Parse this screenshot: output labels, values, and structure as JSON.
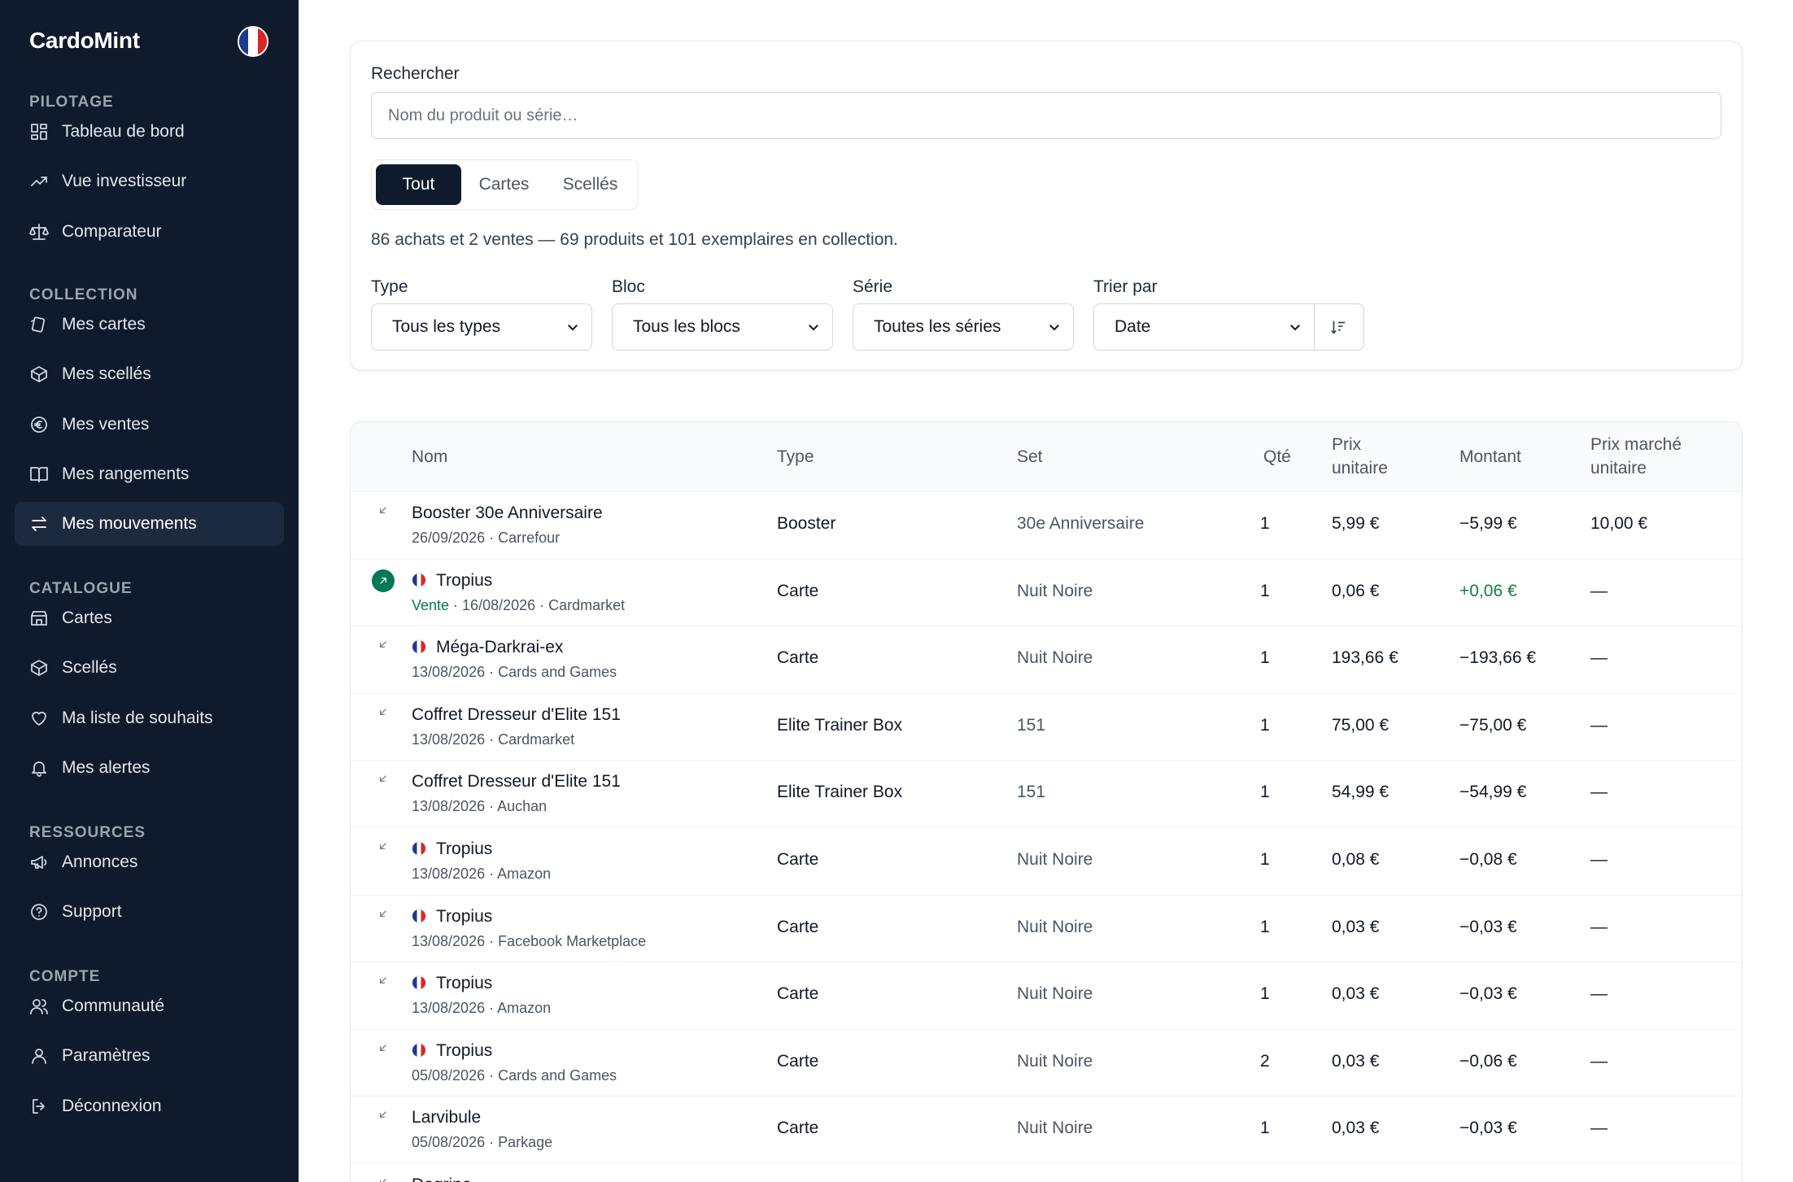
{
  "app": {
    "name": "CardoMint",
    "language_flag_colors": [
      "#1e3a8a",
      "#ffffff",
      "#dc2626"
    ],
    "accent": "#0f1b2d",
    "positive": "#15803d"
  },
  "sidebar": {
    "sections": [
      {
        "title": "PILOTAGE",
        "items": [
          {
            "label": "Tableau de bord",
            "icon": "grid-icon"
          },
          {
            "label": "Vue investisseur",
            "icon": "trending-up-icon"
          },
          {
            "label": "Comparateur",
            "icon": "scale-icon"
          }
        ]
      },
      {
        "title": "COLLECTION",
        "items": [
          {
            "label": "Mes cartes",
            "icon": "cards-icon"
          },
          {
            "label": "Mes scellés",
            "icon": "box-icon"
          },
          {
            "label": "Mes ventes",
            "icon": "euro-icon"
          },
          {
            "label": "Mes rangements",
            "icon": "book-icon"
          },
          {
            "label": "Mes mouvements",
            "icon": "arrows-icon",
            "active": true
          }
        ]
      },
      {
        "title": "CATALOGUE",
        "items": [
          {
            "label": "Cartes",
            "icon": "store-icon"
          },
          {
            "label": "Scellés",
            "icon": "box-icon"
          },
          {
            "label": "Ma liste de souhaits",
            "icon": "heart-icon"
          },
          {
            "label": "Mes alertes",
            "icon": "bell-icon"
          }
        ]
      },
      {
        "title": "RESSOURCES",
        "items": [
          {
            "label": "Annonces",
            "icon": "megaphone-icon"
          },
          {
            "label": "Support",
            "icon": "help-icon"
          }
        ]
      },
      {
        "title": "COMPTE",
        "items": [
          {
            "label": "Communauté",
            "icon": "users-icon"
          },
          {
            "label": "Paramètres",
            "icon": "user-icon"
          },
          {
            "label": "Déconnexion",
            "icon": "logout-icon"
          }
        ]
      }
    ]
  },
  "filters": {
    "search_label": "Rechercher",
    "search_placeholder": "Nom du produit ou série…",
    "search_value": "",
    "segments": [
      "Tout",
      "Cartes",
      "Scellés"
    ],
    "active_segment": "Tout",
    "summary": "86 achats et 2 ventes — 69 produits et 101 exemplaires en collection.",
    "type_label": "Type",
    "type_value": "Tous les types",
    "bloc_label": "Bloc",
    "bloc_value": "Tous les blocs",
    "serie_label": "Série",
    "serie_value": "Toutes les séries",
    "sort_label": "Trier par",
    "sort_value": "Date"
  },
  "table": {
    "headers": {
      "nom": "Nom",
      "type": "Type",
      "set": "Set",
      "qte": "Qté",
      "prix_unitaire": "Prix unitaire",
      "montant": "Montant",
      "prix_marche": "Prix marché unitaire"
    },
    "rows": [
      {
        "direction": "achat",
        "flag": false,
        "name": "Booster 30e Anniversaire",
        "sale_label": "",
        "meta": "26/09/2026 · Carrefour",
        "type": "Booster",
        "set": "30e Anniversaire",
        "qty": "1",
        "unit": "5,99 €",
        "amount": "−5,99 €",
        "market": "10,00 €"
      },
      {
        "direction": "vente",
        "flag": true,
        "name": "Tropius",
        "sale_label": "Vente",
        "meta": " · 16/08/2026 · Cardmarket",
        "type": "Carte",
        "set": "Nuit Noire",
        "qty": "1",
        "unit": "0,06 €",
        "amount": "+0,06 €",
        "market": "—"
      },
      {
        "direction": "achat",
        "flag": true,
        "name": "Méga-Darkrai-ex",
        "sale_label": "",
        "meta": "13/08/2026 · Cards and Games",
        "type": "Carte",
        "set": "Nuit Noire",
        "qty": "1",
        "unit": "193,66 €",
        "amount": "−193,66 €",
        "market": "—"
      },
      {
        "direction": "achat",
        "flag": false,
        "name": "Coffret Dresseur d'Elite 151",
        "sale_label": "",
        "meta": "13/08/2026 · Cardmarket",
        "type": "Elite Trainer Box",
        "set": "151",
        "qty": "1",
        "unit": "75,00 €",
        "amount": "−75,00 €",
        "market": "—"
      },
      {
        "direction": "achat",
        "flag": false,
        "name": "Coffret Dresseur d'Elite 151",
        "sale_label": "",
        "meta": "13/08/2026 · Auchan",
        "type": "Elite Trainer Box",
        "set": "151",
        "qty": "1",
        "unit": "54,99 €",
        "amount": "−54,99 €",
        "market": "—"
      },
      {
        "direction": "achat",
        "flag": true,
        "name": "Tropius",
        "sale_label": "",
        "meta": "13/08/2026 · Amazon",
        "type": "Carte",
        "set": "Nuit Noire",
        "qty": "1",
        "unit": "0,08 €",
        "amount": "−0,08 €",
        "market": "—"
      },
      {
        "direction": "achat",
        "flag": true,
        "name": "Tropius",
        "sale_label": "",
        "meta": "13/08/2026 · Facebook Marketplace",
        "type": "Carte",
        "set": "Nuit Noire",
        "qty": "1",
        "unit": "0,03 €",
        "amount": "−0,03 €",
        "market": "—"
      },
      {
        "direction": "achat",
        "flag": true,
        "name": "Tropius",
        "sale_label": "",
        "meta": "13/08/2026 · Amazon",
        "type": "Carte",
        "set": "Nuit Noire",
        "qty": "1",
        "unit": "0,03 €",
        "amount": "−0,03 €",
        "market": "—"
      },
      {
        "direction": "achat",
        "flag": true,
        "name": "Tropius",
        "sale_label": "",
        "meta": "05/08/2026 · Cards and Games",
        "type": "Carte",
        "set": "Nuit Noire",
        "qty": "2",
        "unit": "0,03 €",
        "amount": "−0,06 €",
        "market": "—"
      },
      {
        "direction": "achat",
        "flag": false,
        "name": "Larvibule",
        "sale_label": "",
        "meta": "05/08/2026 · Parkage",
        "type": "Carte",
        "set": "Nuit Noire",
        "qty": "1",
        "unit": "0,03 €",
        "amount": "−0,03 €",
        "market": "—"
      },
      {
        "direction": "achat",
        "flag": false,
        "name": "Dogrino",
        "sale_label": "",
        "meta": "",
        "type": "",
        "set": "",
        "qty": "",
        "unit": "",
        "amount": "",
        "market": ""
      }
    ]
  }
}
